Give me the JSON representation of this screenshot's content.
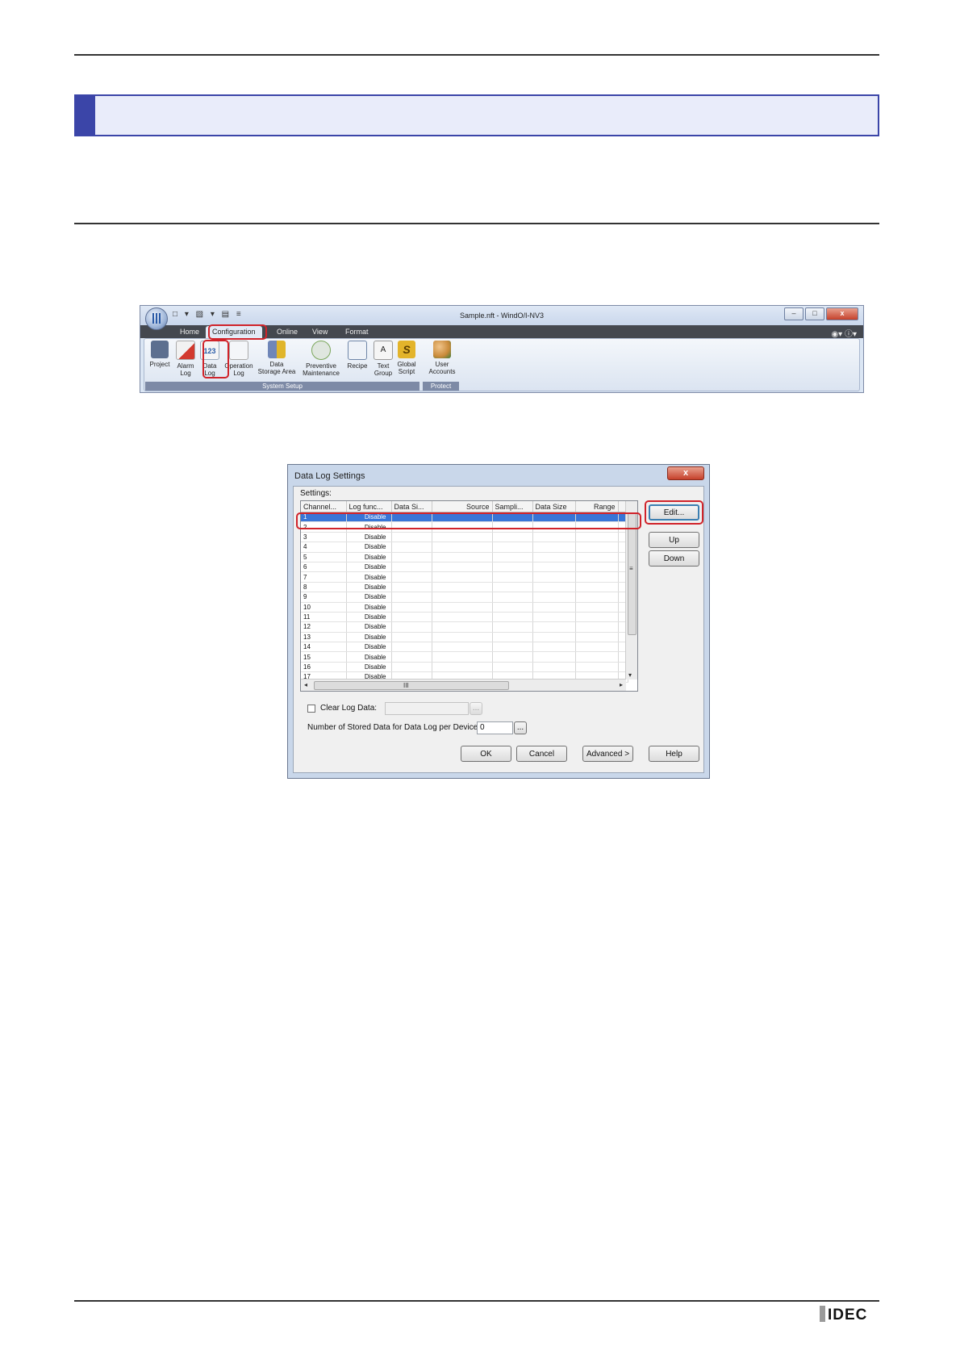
{
  "ribbon": {
    "window_title": "Sample.nft - WindO/I-NV3",
    "qat_icons": "□ ▾ ▧ ▾ ▤ ≡",
    "tabs": [
      "Home",
      "Configuration",
      "Online",
      "View",
      "Format"
    ],
    "right_icons": "◉▾ ⓘ▾",
    "window_buttons": [
      "–",
      "□",
      "x"
    ],
    "items": [
      {
        "line1": "Project",
        "line2": "",
        "icon": "project-icon",
        "color": "#5c6f8f"
      },
      {
        "line1": "Alarm",
        "line2": "Log",
        "icon": "alarm-log-icon",
        "color": "#d23a2f"
      },
      {
        "line1": "Data",
        "line2": "Log",
        "icon": "data-log-icon",
        "color": "#6aa0d8"
      },
      {
        "line1": "Operation",
        "line2": "Log",
        "icon": "operation-log-icon",
        "color": "#e1e8f2"
      },
      {
        "line1": "Data",
        "line2": "Storage Area",
        "icon": "data-storage-area-icon",
        "color": "#e0b52a"
      },
      {
        "line1": "Preventive",
        "line2": "Maintenance",
        "icon": "preventive-maintenance-icon",
        "color": "#7aa65a"
      },
      {
        "line1": "Recipe",
        "line2": "",
        "icon": "recipe-icon",
        "color": "#6f86a8"
      },
      {
        "line1": "Text",
        "line2": "Group",
        "icon": "text-group-icon",
        "color": "#d8d8d8"
      },
      {
        "line1": "Global",
        "line2": "Script",
        "icon": "global-script-icon",
        "color": "#e3b42b"
      },
      {
        "line1": "User",
        "line2": "Accounts",
        "icon": "user-accounts-icon",
        "color": "#c98a3a"
      }
    ],
    "groups": [
      "System Setup",
      "Protect"
    ]
  },
  "dialog": {
    "title": "Data Log Settings",
    "close_label": "x",
    "settings_label": "Settings:",
    "columns": [
      "Channel...",
      "Log func...",
      "Data Si...",
      "Source",
      "Sampli...",
      "Data Size",
      "Range"
    ],
    "rows": [
      {
        "channel": "1",
        "log": "Disable"
      },
      {
        "channel": "2",
        "log": "Disable"
      },
      {
        "channel": "3",
        "log": "Disable"
      },
      {
        "channel": "4",
        "log": "Disable"
      },
      {
        "channel": "5",
        "log": "Disable"
      },
      {
        "channel": "6",
        "log": "Disable"
      },
      {
        "channel": "7",
        "log": "Disable"
      },
      {
        "channel": "8",
        "log": "Disable"
      },
      {
        "channel": "9",
        "log": "Disable"
      },
      {
        "channel": "10",
        "log": "Disable"
      },
      {
        "channel": "11",
        "log": "Disable"
      },
      {
        "channel": "12",
        "log": "Disable"
      },
      {
        "channel": "13",
        "log": "Disable"
      },
      {
        "channel": "14",
        "log": "Disable"
      },
      {
        "channel": "15",
        "log": "Disable"
      },
      {
        "channel": "16",
        "log": "Disable"
      },
      {
        "channel": "17",
        "log": "Disable"
      }
    ],
    "buttons": {
      "edit": "Edit...",
      "up": "Up",
      "down": "Down",
      "ok": "OK",
      "cancel": "Cancel",
      "advanced": "Advanced >",
      "help": "Help"
    },
    "clear_log_label": "Clear Log Data:",
    "stored_label": "Number of Stored Data for Data Log per Device:",
    "stored_value": "0",
    "browse": "...",
    "scroll": {
      "left": "◂",
      "right": "▸",
      "down": "▾",
      "grip": "III",
      "vgrip": "≡"
    }
  },
  "footer": {
    "logo": "IDEC"
  },
  "colors": {
    "accent": "#3b45a8",
    "highlight": "#d0232a",
    "selection": "#3875d7"
  }
}
